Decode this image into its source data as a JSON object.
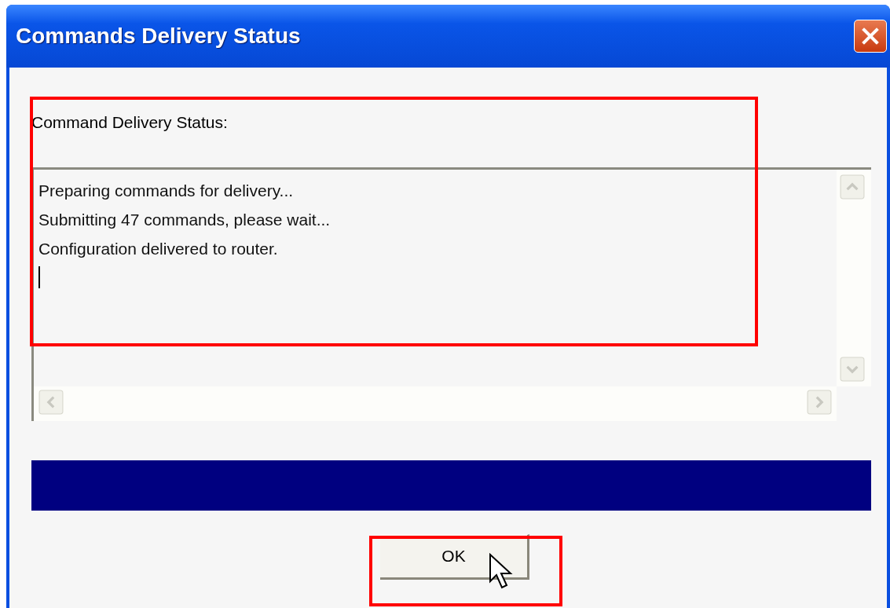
{
  "window": {
    "title": "Commands Delivery Status"
  },
  "status_label": "Command Delivery Status:",
  "log": {
    "lines": [
      "Preparing commands for delivery...",
      "Submitting 47 commands, please wait...",
      "Configuration delivered to router."
    ],
    "caret": true
  },
  "buttons": [
    {
      "label": "OK"
    }
  ],
  "annotations": {
    "status_area_highlighted": true,
    "ok_button_highlighted": true
  }
}
